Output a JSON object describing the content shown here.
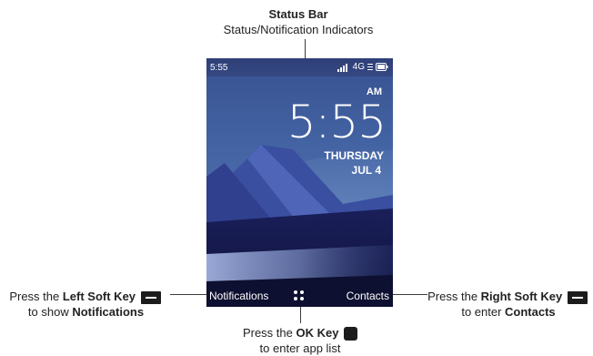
{
  "callouts": {
    "status_title": "Status Bar",
    "status_sub": "Status/Notification Indicators",
    "left": {
      "prefix": "Press the ",
      "key": "Left Soft Key",
      "line2_prefix": "to show ",
      "line2_bold": "Notifications"
    },
    "right": {
      "prefix": "Press the ",
      "key": "Right Soft Key",
      "line2_prefix": "to enter ",
      "line2_bold": "Contacts"
    },
    "ok": {
      "prefix": "Press the ",
      "key": "OK Key",
      "line2": "to enter app list"
    }
  },
  "phone": {
    "status_bar": {
      "time": "5:55",
      "network": "4G",
      "icons": [
        "signal-icon",
        "network-icon",
        "battery-icon"
      ]
    },
    "clock": {
      "ampm": "AM",
      "time": "5:55",
      "day": "THURSDAY",
      "date": "JUL 4"
    },
    "softkeys": {
      "left": "Notifications",
      "center_icon": "apps-grid-icon",
      "right": "Contacts"
    }
  },
  "colors": {
    "leader": "#3d3d3d",
    "key": "#1c1c1c",
    "sky": "#4a6aa8",
    "mountain": "#2d3b85"
  }
}
